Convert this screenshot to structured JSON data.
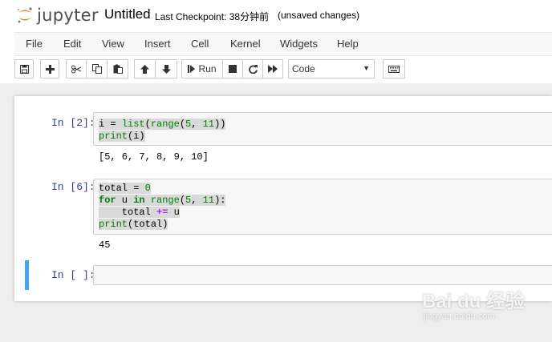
{
  "header": {
    "logo_text": "jupyter",
    "notebook_title": "Untitled",
    "checkpoint": "Last Checkpoint: 38分钟前",
    "unsaved": "(unsaved changes)"
  },
  "menu": [
    "File",
    "Edit",
    "View",
    "Insert",
    "Cell",
    "Kernel",
    "Widgets",
    "Help"
  ],
  "toolbar": {
    "run_label": "Run",
    "cell_type": "Code",
    "buttons": [
      "save-icon",
      "add-cell-icon",
      "cut-icon",
      "copy-icon",
      "paste-icon",
      "move-up-icon",
      "move-down-icon",
      "run-icon",
      "stop-icon",
      "restart-icon",
      "fast-forward-icon",
      "keyboard-icon"
    ]
  },
  "cells": [
    {
      "prompt": "In [2]:",
      "output": "[5, 6, 7, 8, 9, 10]"
    },
    {
      "prompt": "In [6]:",
      "output": "45"
    },
    {
      "prompt": "In [ ]:"
    }
  ],
  "watermark": {
    "main": "Bai du 经验",
    "sub": "jingyan.baidu.com"
  },
  "colors": {
    "prompt": "#303f9f",
    "keyword": "#008000",
    "active_cell_bar": "#42a5f5"
  }
}
